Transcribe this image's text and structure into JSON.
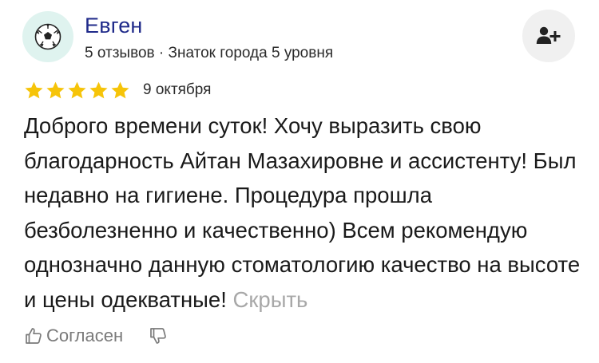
{
  "author": {
    "name": "Евген",
    "meta": "5 отзывов · Знаток города 5 уровня",
    "avatar_icon": "soccer-ball-icon"
  },
  "follow_button": {
    "icon": "add-user-icon"
  },
  "review": {
    "rating": 5,
    "rating_max": 5,
    "date": "9 октября",
    "text": "Доброго времени суток! Хочу выразить свою благодарность Айтан Мазахировне и ассистенту! Был недавно на гигиене. Процедура прошла безболезненно и качественно) Всем рекомендую однозначно данную стоматологию качество на высоте и цены одекватные!",
    "hide_label": "Скрыть"
  },
  "actions": {
    "agree_label": "Согласен",
    "agree_icon": "thumbs-up-icon",
    "dislike_icon": "thumbs-down-icon"
  },
  "colors": {
    "author_name": "#1f2a8a",
    "star": "#f6c409",
    "avatar_bg": "#dff3ef",
    "follow_bg": "#f0f0f0",
    "muted": "#a8a8a8"
  }
}
